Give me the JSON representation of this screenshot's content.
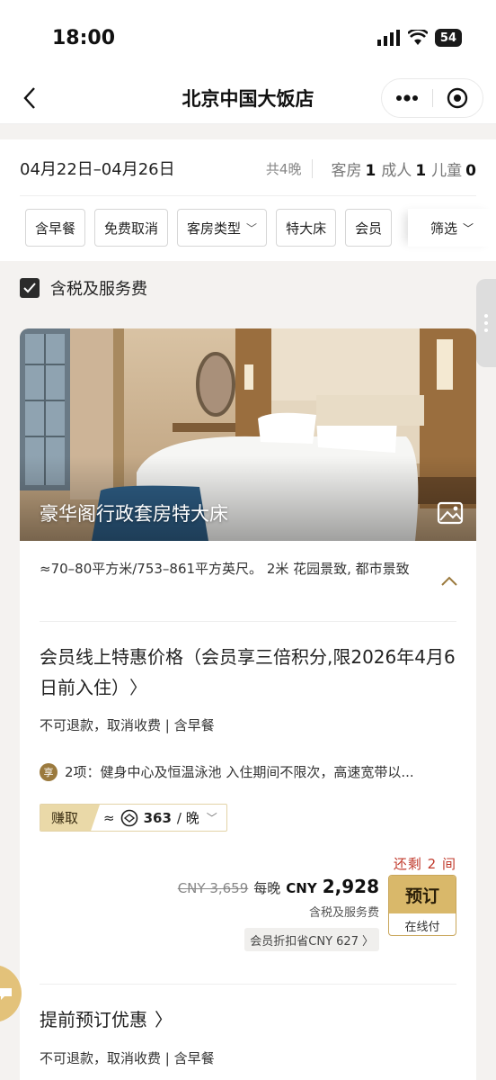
{
  "status": {
    "time": "18:00",
    "battery": "54"
  },
  "nav": {
    "title": "北京中国大饭店"
  },
  "search": {
    "dates": "04月22日–04月26日",
    "nights": "共4晚",
    "rooms_label": "客房",
    "rooms_value": "1",
    "adults_label": "成人",
    "adults_value": "1",
    "children_label": "儿童",
    "children_value": "0"
  },
  "chips": [
    {
      "label": "含早餐"
    },
    {
      "label": "免费取消"
    },
    {
      "label": "客房类型"
    },
    {
      "label": "特大床"
    },
    {
      "label": "会员"
    }
  ],
  "filter_label": "筛选",
  "tax_toggle": {
    "label": "含税及服务费",
    "checked": true
  },
  "room": {
    "name": "豪华阁行政套房特大床",
    "info": "≈70–80平方米/753–861平方英尺。   2米   花园景致, 都市景致"
  },
  "rate": {
    "title": "会员线上特惠价格（会员享三倍积分,限2026年4月6日前入住）",
    "policy": "不可退款，取消收费 | 含早餐",
    "perk_badge": "享",
    "perks": "2项：健身中心及恒温泳池 入住期间不限次，高速宽带以...",
    "earn_label": "赚取",
    "earn_approx": "≈",
    "earn_points": "363",
    "earn_unit": "/ 晚",
    "remaining": "还剩 2 间",
    "original_price": "CNY 3,659",
    "per_night": "每晚",
    "currency": "CNY",
    "price": "2,928",
    "tax_note": "含税及服务费",
    "discount": "会员折扣省CNY 627",
    "book_label": "预订",
    "pay_label": "在线付"
  },
  "rate2": {
    "title": "提前预订优惠",
    "policy": "不可退款，取消收费 | 含早餐"
  },
  "colors": {
    "gold": "#d9b86a",
    "accent_red": "#c0392b",
    "earn_bg": "#ead9a8"
  }
}
